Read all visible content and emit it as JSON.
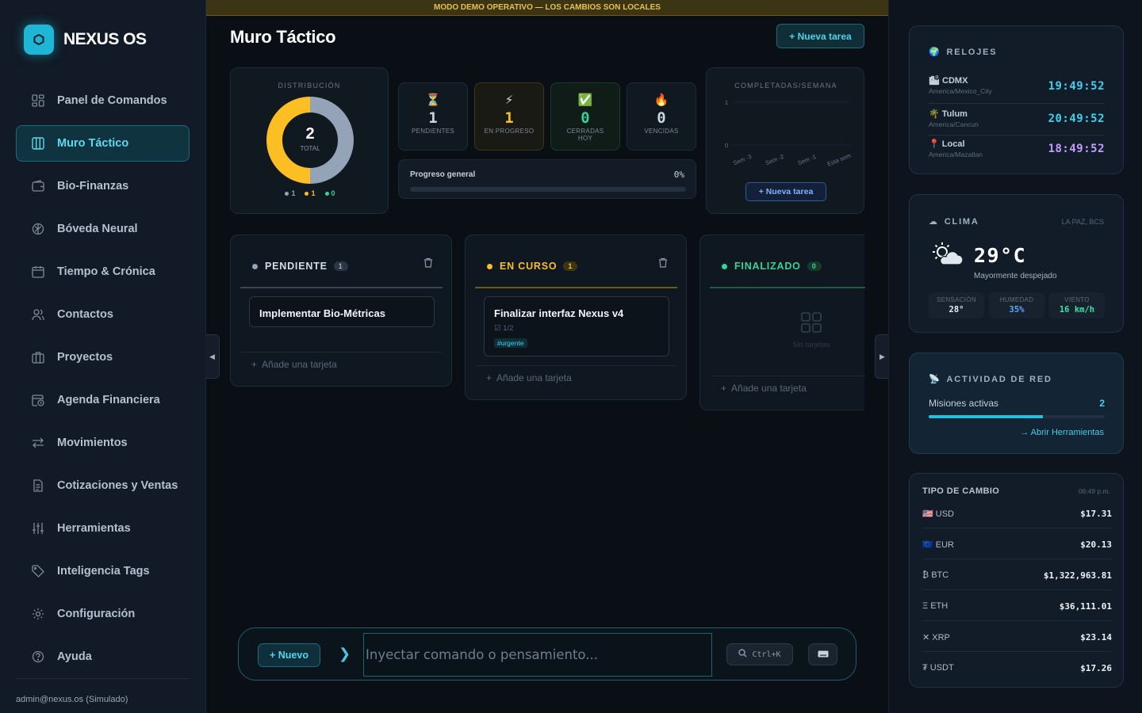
{
  "brand": {
    "name": "NEXUS OS",
    "accent": "#1fb6d6"
  },
  "sidebar": {
    "items": [
      {
        "label": "Panel de Comandos",
        "icon": "grid-icon"
      },
      {
        "label": "Muro Táctico",
        "icon": "columns-icon",
        "active": true
      },
      {
        "label": "Bio-Finanzas",
        "icon": "wallet-icon"
      },
      {
        "label": "Bóveda Neural",
        "icon": "brain-icon"
      },
      {
        "label": "Tiempo & Crónica",
        "icon": "calendar-icon"
      },
      {
        "label": "Contactos",
        "icon": "users-icon"
      },
      {
        "label": "Proyectos",
        "icon": "briefcase-icon"
      },
      {
        "label": "Agenda Financiera",
        "icon": "calendar-clock-icon"
      },
      {
        "label": "Movimientos",
        "icon": "arrows-icon"
      },
      {
        "label": "Cotizaciones y Ventas",
        "icon": "receipt-icon"
      },
      {
        "label": "Herramientas",
        "icon": "sliders-icon"
      },
      {
        "label": "Inteligencia Tags",
        "icon": "tag-icon"
      },
      {
        "label": "Configuración",
        "icon": "gear-icon"
      },
      {
        "label": "Ayuda",
        "icon": "help-icon"
      }
    ],
    "user": "admin@nexus.os (Simulado)"
  },
  "banner": "MODO DEMO OPERATIVO — LOS CAMBIOS SON LOCALES",
  "header": {
    "title": "Muro Táctico",
    "new_task": "+ Nueva tarea"
  },
  "distribution": {
    "caption": "DISTRIBUCIÓN",
    "total": "2",
    "total_label": "TOTAL",
    "legend": [
      "1",
      "1",
      "0"
    ],
    "segments": [
      {
        "value": 1,
        "color": "#94a3b8"
      },
      {
        "value": 1,
        "color": "#fbbf24"
      },
      {
        "value": 0,
        "color": "#34d399"
      }
    ]
  },
  "stats": [
    {
      "emoji": "⏳",
      "value": "1",
      "label": "PENDIENTES",
      "color": "#cbd5e1"
    },
    {
      "emoji": "⚡",
      "value": "1",
      "label": "EN PROGRESO",
      "color": "#fbbf24"
    },
    {
      "emoji": "✅",
      "value": "0",
      "label": "CERRADAS HOY",
      "color": "#34d399"
    },
    {
      "emoji": "🔥",
      "value": "0",
      "label": "VENCIDAS",
      "color": "#cbd5e1"
    }
  ],
  "progress": {
    "label": "Progreso general",
    "pct_text": "0%",
    "pct": 0
  },
  "chart_data": {
    "type": "line",
    "title": "COMPLETADAS/SEMANA",
    "categories": [
      "Sem -3",
      "Sem -2",
      "Sem -1",
      "Esta sem"
    ],
    "values": [
      0,
      0,
      0,
      0
    ],
    "ylim": [
      0,
      1
    ],
    "yticks": [
      "0",
      "1"
    ],
    "grid": true,
    "button": "+ Nueva tarea"
  },
  "columns": [
    {
      "title": "PENDIENTE",
      "count": "1",
      "color": "#94a3b8",
      "cards": [
        {
          "title": "Implementar Bio-Métricas"
        }
      ],
      "add": "Añade una tarjeta"
    },
    {
      "title": "EN CURSO",
      "count": "1",
      "color": "#fbbf24",
      "cards": [
        {
          "title": "Finalizar interfaz Nexus v4",
          "checklist": "1/2",
          "tag": "#urgente"
        }
      ],
      "add": "Añade una tarjeta"
    },
    {
      "title": "FINALIZADO",
      "count": "0",
      "color": "#34d399",
      "empty": "Sin tarjetas",
      "add": "Añade una tarjeta"
    }
  ],
  "command_bar": {
    "new_label": "+ Nuevo",
    "placeholder": "Inyectar comando o pensamiento...",
    "shortcut": "Ctrl+K"
  },
  "clocks": {
    "caption": "RELOJES",
    "items": [
      {
        "icon": "🏙",
        "name": "CDMX",
        "tz": "America/Mexico_City",
        "time": "19:49:52",
        "color": "#3fd0ec"
      },
      {
        "icon": "🌴",
        "name": "Tulum",
        "tz": "America/Cancun",
        "time": "20:49:52",
        "color": "#3fd0ec"
      },
      {
        "icon": "📍",
        "name": "Local",
        "tz": "America/Mazatlan",
        "time": "18:49:52",
        "color": "#c59cff"
      }
    ]
  },
  "weather": {
    "caption": "CLIMA",
    "location": "LA PAZ, BCS",
    "temp": "29°C",
    "desc": "Mayormente despejado",
    "boxes": [
      {
        "k": "SENSACIÓN",
        "v": "28°",
        "color": "#e6edf5"
      },
      {
        "k": "HUMEDAD",
        "v": "35%",
        "color": "#5ea7ff"
      },
      {
        "k": "VIENTO",
        "v": "16 km/h",
        "color": "#3fe0a6"
      }
    ]
  },
  "network": {
    "caption": "ACTIVIDAD DE RED",
    "label": "Misiones activas",
    "value": "2",
    "fill": 0.65,
    "link": "→ Abrir Herramientas"
  },
  "fx": {
    "title": "TIPO DE CAMBIO",
    "time": "06:49 p.m.",
    "rows": [
      {
        "c": "🇺🇸 USD",
        "v": "$17.31"
      },
      {
        "c": "🇪🇺 EUR",
        "v": "$20.13"
      },
      {
        "c": "₿ BTC",
        "v": "$1,322,963.81"
      },
      {
        "c": "Ξ ETH",
        "v": "$36,111.01"
      },
      {
        "c": "✕ XRP",
        "v": "$23.14"
      },
      {
        "c": "₮ USDT",
        "v": "$17.26"
      }
    ]
  }
}
